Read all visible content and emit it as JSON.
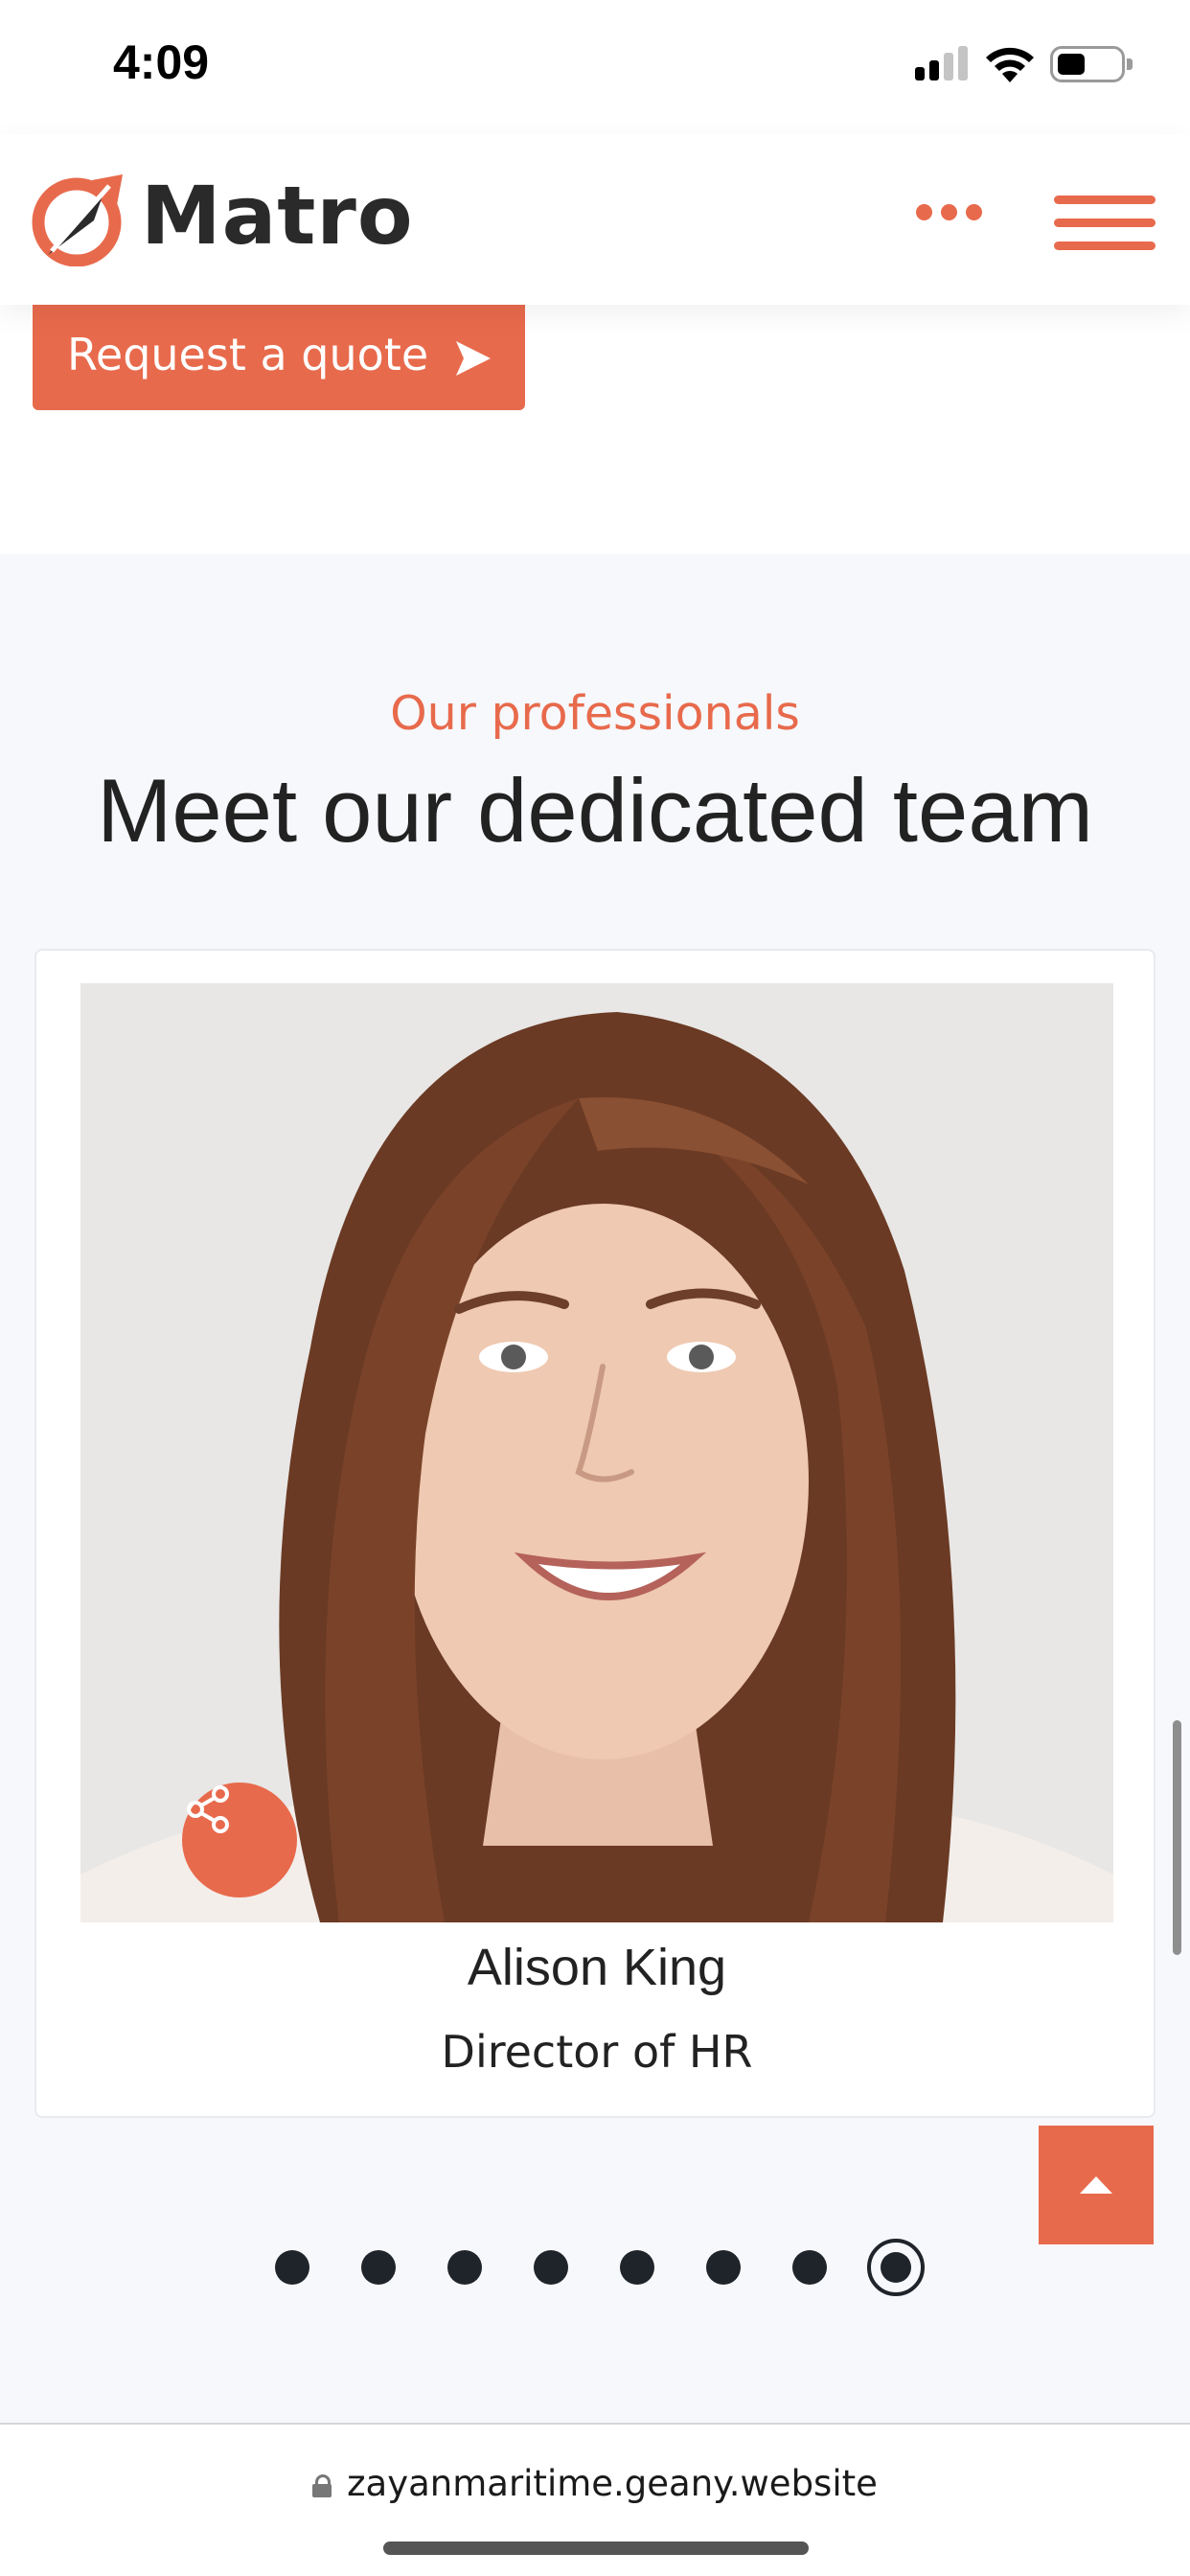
{
  "status_bar": {
    "time": "4:09"
  },
  "header": {
    "logo_text": "Matro",
    "accent_color": "#e86a4c",
    "icons": [
      "logo-icon",
      "more-dots-icon",
      "hamburger-menu-icon"
    ]
  },
  "quote": {
    "label": "Request a quote",
    "icon": "send-arrow-icon"
  },
  "team": {
    "eyebrow": "Our professionals",
    "title": "Meet our dedicated team",
    "member": {
      "name": "Alison King",
      "role": "Director of HR"
    },
    "share_icon": "share-icon",
    "pager": {
      "count": 8,
      "active_index": 7
    }
  },
  "back_to_top_icon": "arrow-up-icon",
  "browser": {
    "url": "zayanmaritime.geany.website"
  }
}
